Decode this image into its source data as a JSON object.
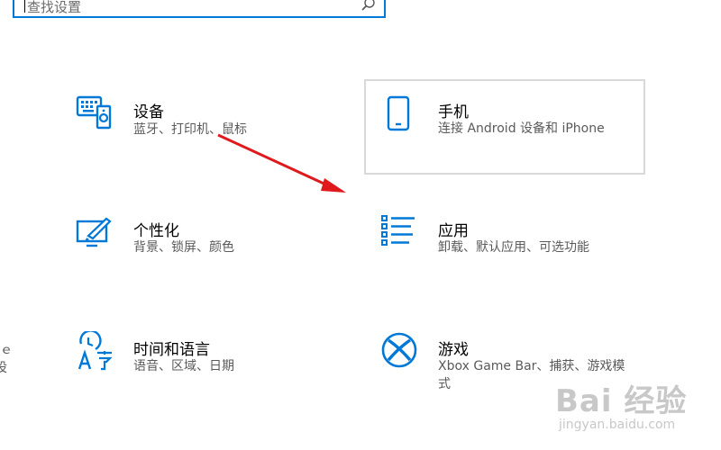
{
  "search": {
    "placeholder": "查找设置"
  },
  "tiles": {
    "devices": {
      "title": "设备",
      "desc": "蓝牙、打印机、鼠标"
    },
    "phone": {
      "title": "手机",
      "desc": "连接 Android 设备和 iPhone"
    },
    "personalization": {
      "title": "个性化",
      "desc": "背景、锁屏、颜色"
    },
    "apps": {
      "title": "应用",
      "desc": "卸载、默认应用、可选功能"
    },
    "time_language": {
      "title": "时间和语言",
      "desc": "语音、区域、日期"
    },
    "gaming": {
      "title": "游戏",
      "desc": "Xbox Game Bar、捕获、游戏模式"
    }
  },
  "edge_fragments": {
    "line1": "ｅ",
    "line2": "设"
  },
  "watermark": {
    "brand": "Bai 经验",
    "url": "jingyan.baidu.com"
  },
  "colors": {
    "accent": "#0078d7",
    "arrow": "#e0191c"
  }
}
